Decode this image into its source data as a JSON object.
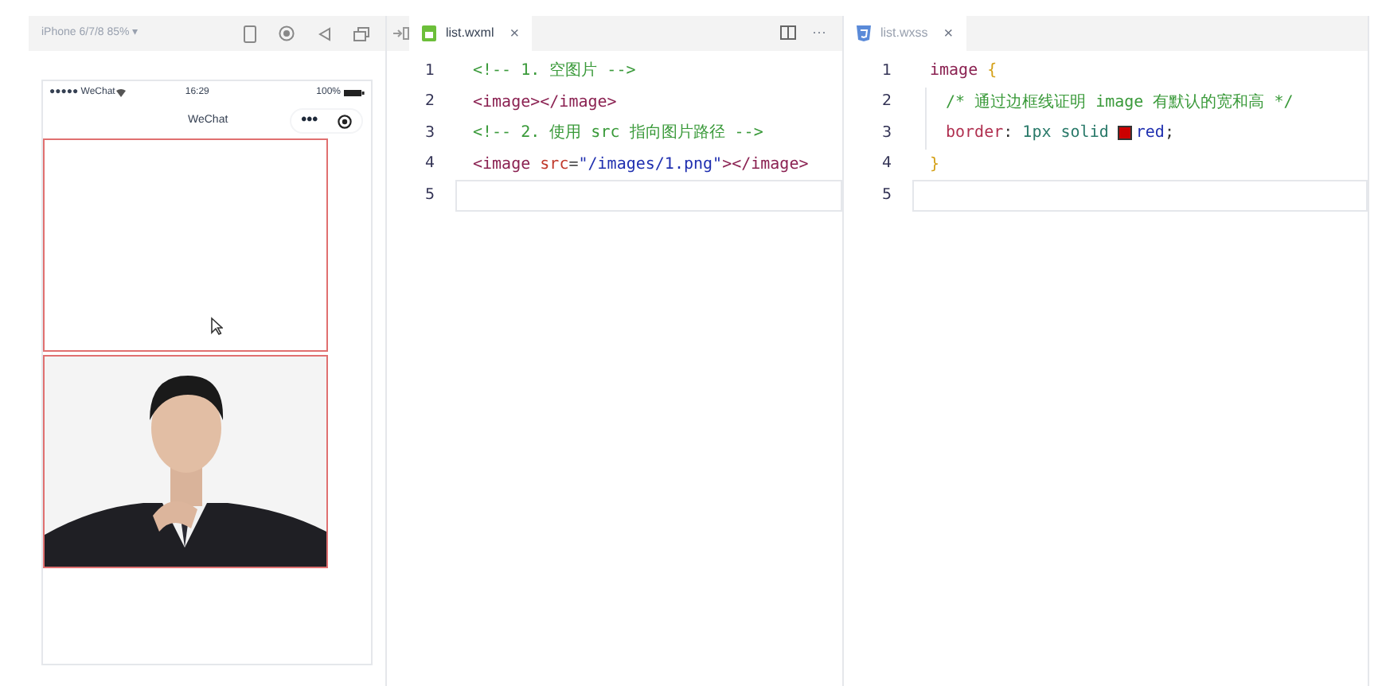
{
  "simulator": {
    "device": "iPhone 6/7/8 85% ▾",
    "status_bar": {
      "carrier": "●●●●● WeChat",
      "time": "16:29",
      "battery": "100%"
    },
    "nav_title": "WeChat",
    "capsule_menu": "•••",
    "images": [
      {
        "kind": "empty"
      },
      {
        "kind": "picture"
      }
    ]
  },
  "editors": [
    {
      "tab": {
        "label": "list.wxml",
        "kind": "markup",
        "selected": true,
        "close": "×"
      },
      "more": "···",
      "lines": [
        {
          "number": "1",
          "current": false,
          "tokens": [
            {
              "kind": "comment",
              "text": "<!-- 1. 空图片 -->"
            }
          ]
        },
        {
          "number": "2",
          "current": false,
          "tokens": [
            {
              "kind": "tag",
              "text": "<image></image>"
            }
          ]
        },
        {
          "number": "3",
          "current": false,
          "tokens": [
            {
              "kind": "comment",
              "text": "<!-- 2. 使用 src 指向图片路径 -->"
            }
          ]
        },
        {
          "number": "4",
          "current": false,
          "tokens": [
            {
              "kind": "tag",
              "text": "<image "
            },
            {
              "kind": "attr",
              "text": "src"
            },
            {
              "kind": "punct",
              "text": "="
            },
            {
              "kind": "string",
              "text": "\"/images/1.png\""
            },
            {
              "kind": "tag",
              "text": "></image>"
            }
          ]
        },
        {
          "number": "5",
          "current": true
        }
      ]
    },
    {
      "tab": {
        "label": "list.wxss",
        "kind": "style",
        "selected": false,
        "close": "×"
      },
      "lines": [
        {
          "number": "1",
          "current": false,
          "tokens": [
            {
              "kind": "selector",
              "text": "image "
            },
            {
              "kind": "brace",
              "text": "{"
            }
          ]
        },
        {
          "number": "2",
          "current": false,
          "indent": true,
          "tokens": [
            {
              "kind": "comment",
              "text": "/* 通过边框线证明 image 有默认的宽和高 */"
            }
          ]
        },
        {
          "number": "3",
          "current": false,
          "indent": true,
          "tokens": [
            {
              "kind": "property",
              "text": "border"
            },
            {
              "kind": "punct",
              "text": ": "
            },
            {
              "kind": "number",
              "text": "1px solid "
            },
            {
              "kind": "swatch"
            },
            {
              "kind": "value",
              "text": "red"
            },
            {
              "kind": "punct",
              "text": ";"
            }
          ]
        },
        {
          "number": "4",
          "current": false,
          "tokens": [
            {
              "kind": "brace",
              "text": "}"
            }
          ]
        },
        {
          "number": "5",
          "current": true
        }
      ]
    }
  ]
}
